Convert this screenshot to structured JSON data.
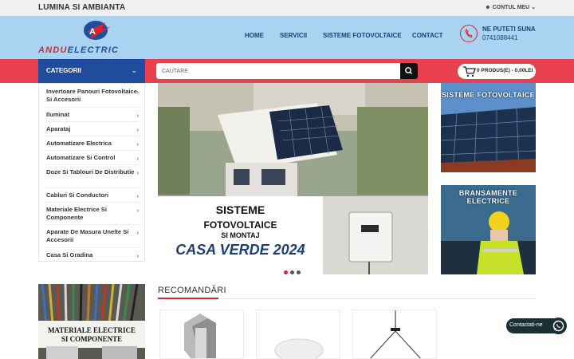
{
  "topbar": {
    "tagline": "LUMINA SI AMBIANTA",
    "account_label": "CONTUL MEU"
  },
  "header": {
    "logo_text_a": "ANDU",
    "logo_text_b": "ELECTRIC",
    "nav": [
      "HOME",
      "SERVICII",
      "SISTEME FOTOVOLTAICE",
      "CONTACT"
    ],
    "phone_label": "NE PUTETI SUNA",
    "phone_number": "0741088441"
  },
  "categories": {
    "heading": "CATEGORII",
    "items": [
      "Invertoare Panouri Fotovoltaice Si Accesorii",
      "Iluminat",
      "Aparataj",
      "Automatizare Electrica",
      "Automatizare Si Control",
      "Doze Si Tablouri De Distributie",
      "Cabluri Si Conductori",
      "Materiale Electrice Si Componente",
      "Aparate De Masura Unelte Si Accesorii",
      "Casa Si Gradina"
    ]
  },
  "search": {
    "placeholder": "CAUTARE"
  },
  "cart": {
    "summary": "0 PRODUS(E) - 0,00LEI"
  },
  "hero": {
    "line1": "SISTEME",
    "line2": "FOTOVOLTAICE",
    "line3": "SI MONTAJ",
    "line4": "CASA VERDE 2024",
    "slide_count": 3,
    "active_slide": 1
  },
  "promos": [
    {
      "title": "SISTEME FOTOVOLTAICE"
    },
    {
      "title": "BRANSAMENTE ELECTRICE"
    }
  ],
  "banner_side": {
    "line1": "MATERIALE ELECTRICE",
    "line2": "SI COMPONENTE"
  },
  "recommended": {
    "title": "RECOMANDĂRI"
  },
  "contact_widget": {
    "label": "Contactati-ne"
  },
  "colors": {
    "brand_blue": "#1f4c9c",
    "brand_red": "#e8404c",
    "header_bg": "#a9d3f0"
  }
}
